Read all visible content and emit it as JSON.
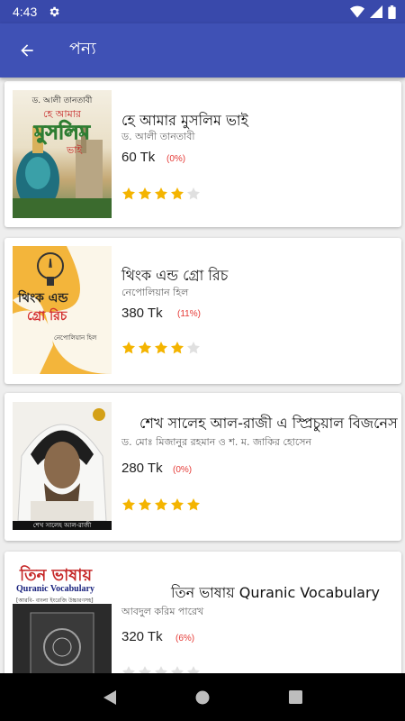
{
  "status": {
    "time": "4:43"
  },
  "app_bar": {
    "title": "পন্য"
  },
  "colors": {
    "app_bar": "#3f51b5",
    "status_bar": "#3949ab",
    "star_filled": "#f4b400",
    "star_empty": "#e0e0e0",
    "discount": "#e53935"
  },
  "books": [
    {
      "title": "হে আমার মুসলিম ভাই",
      "author": "ড. আলী তানতাবী",
      "price": "60 Tk",
      "discount": "(0%)",
      "rating": 4
    },
    {
      "title": "থিংক এন্ড গ্রো রিচ",
      "author": "নেপোলিয়ান হিল",
      "price": "380 Tk",
      "discount": "(11%)",
      "rating": 4
    },
    {
      "title": "শেখ সালেহ আল-রাজী এ স্প্রিচুয়াল বিজনেস",
      "author": "ড. মোঃ মিজানুর রহমান ও শ. ম. জাকির হোসেন",
      "price": "280 Tk",
      "discount": "(0%)",
      "rating": 5
    },
    {
      "title": "তিন ভাষায় Quranic Vocabulary",
      "author": "আবদুল করিম পারেখ",
      "price": "320 Tk",
      "discount": "(6%)",
      "rating": 0
    }
  ],
  "covers": {
    "c1_top": "ড. আলী তানতাবী",
    "c1_mid": "হে আমার",
    "c1_big": "মুসলিম",
    "c1_bot": "ভাই",
    "c2_line1": "থিংক এন্ড",
    "c2_line2": "গ্রো রিচ",
    "c2_author": "নেপোলিয়ান হিল",
    "c3_caption": "শেখ সালেহ আল-রাজী",
    "c4_top": "তিন ভাষায়",
    "c4_sub": "Quranic Vocabulary",
    "c4_line": "[আরবি- বাংলা ইংরেজি উচ্চারণসহ]"
  }
}
